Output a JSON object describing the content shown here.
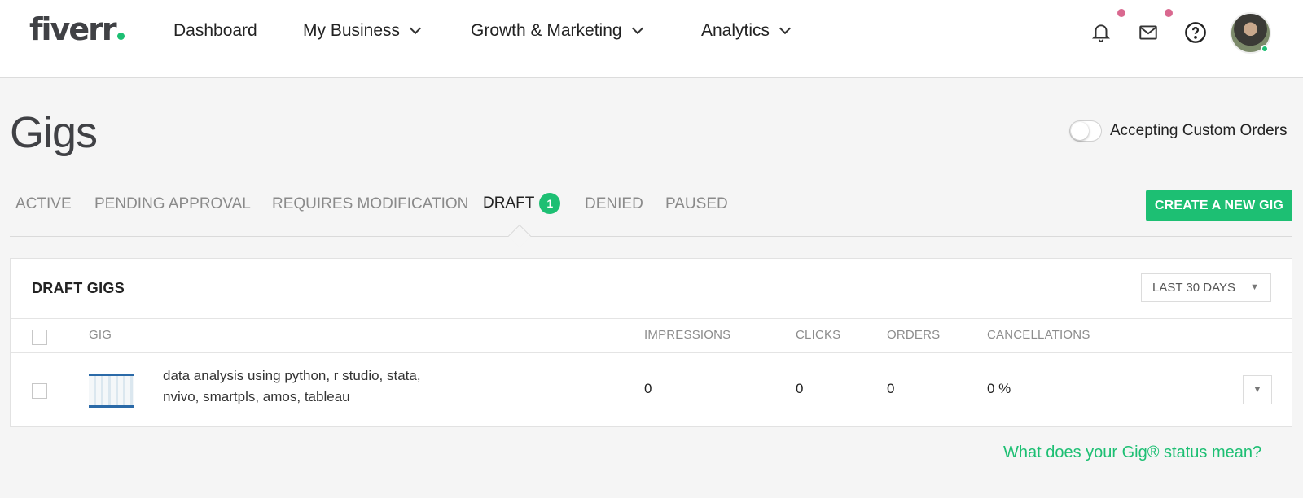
{
  "header": {
    "logo": "fiverr",
    "nav": [
      {
        "label": "Dashboard",
        "dropdown": false
      },
      {
        "label": "My Business",
        "dropdown": true
      },
      {
        "label": "Growth & Marketing",
        "dropdown": true
      },
      {
        "label": "Analytics",
        "dropdown": true
      }
    ],
    "icons": [
      "bell-icon",
      "envelope-icon",
      "help-circle-icon",
      "avatar"
    ]
  },
  "page": {
    "title": "Gigs",
    "custom_orders_label": "Accepting Custom Orders",
    "custom_orders_enabled": false
  },
  "tabs": [
    {
      "label": "ACTIVE",
      "active": false
    },
    {
      "label": "PENDING APPROVAL",
      "active": false
    },
    {
      "label": "REQUIRES MODIFICATION",
      "active": false
    },
    {
      "label": "DRAFT",
      "count": "1",
      "active": true
    },
    {
      "label": "DENIED",
      "active": false
    },
    {
      "label": "PAUSED",
      "active": false
    }
  ],
  "create_button": "CREATE A NEW GIG",
  "table": {
    "title": "DRAFT GIGS",
    "range": "LAST 30 DAYS",
    "columns": [
      "GIG",
      "IMPRESSIONS",
      "CLICKS",
      "ORDERS",
      "CANCELLATIONS"
    ],
    "rows": [
      {
        "gig": "data analysis using python, r studio, stata, nvivo, smartpls, amos, tableau",
        "impressions": "0",
        "clicks": "0",
        "orders": "0",
        "cancellations": "0 %"
      }
    ]
  },
  "help_link": "What does your Gig® status mean?",
  "colors": {
    "brand_green": "#1dbf73",
    "notification_dot": "#d9688f",
    "logo_text": "#404145"
  }
}
